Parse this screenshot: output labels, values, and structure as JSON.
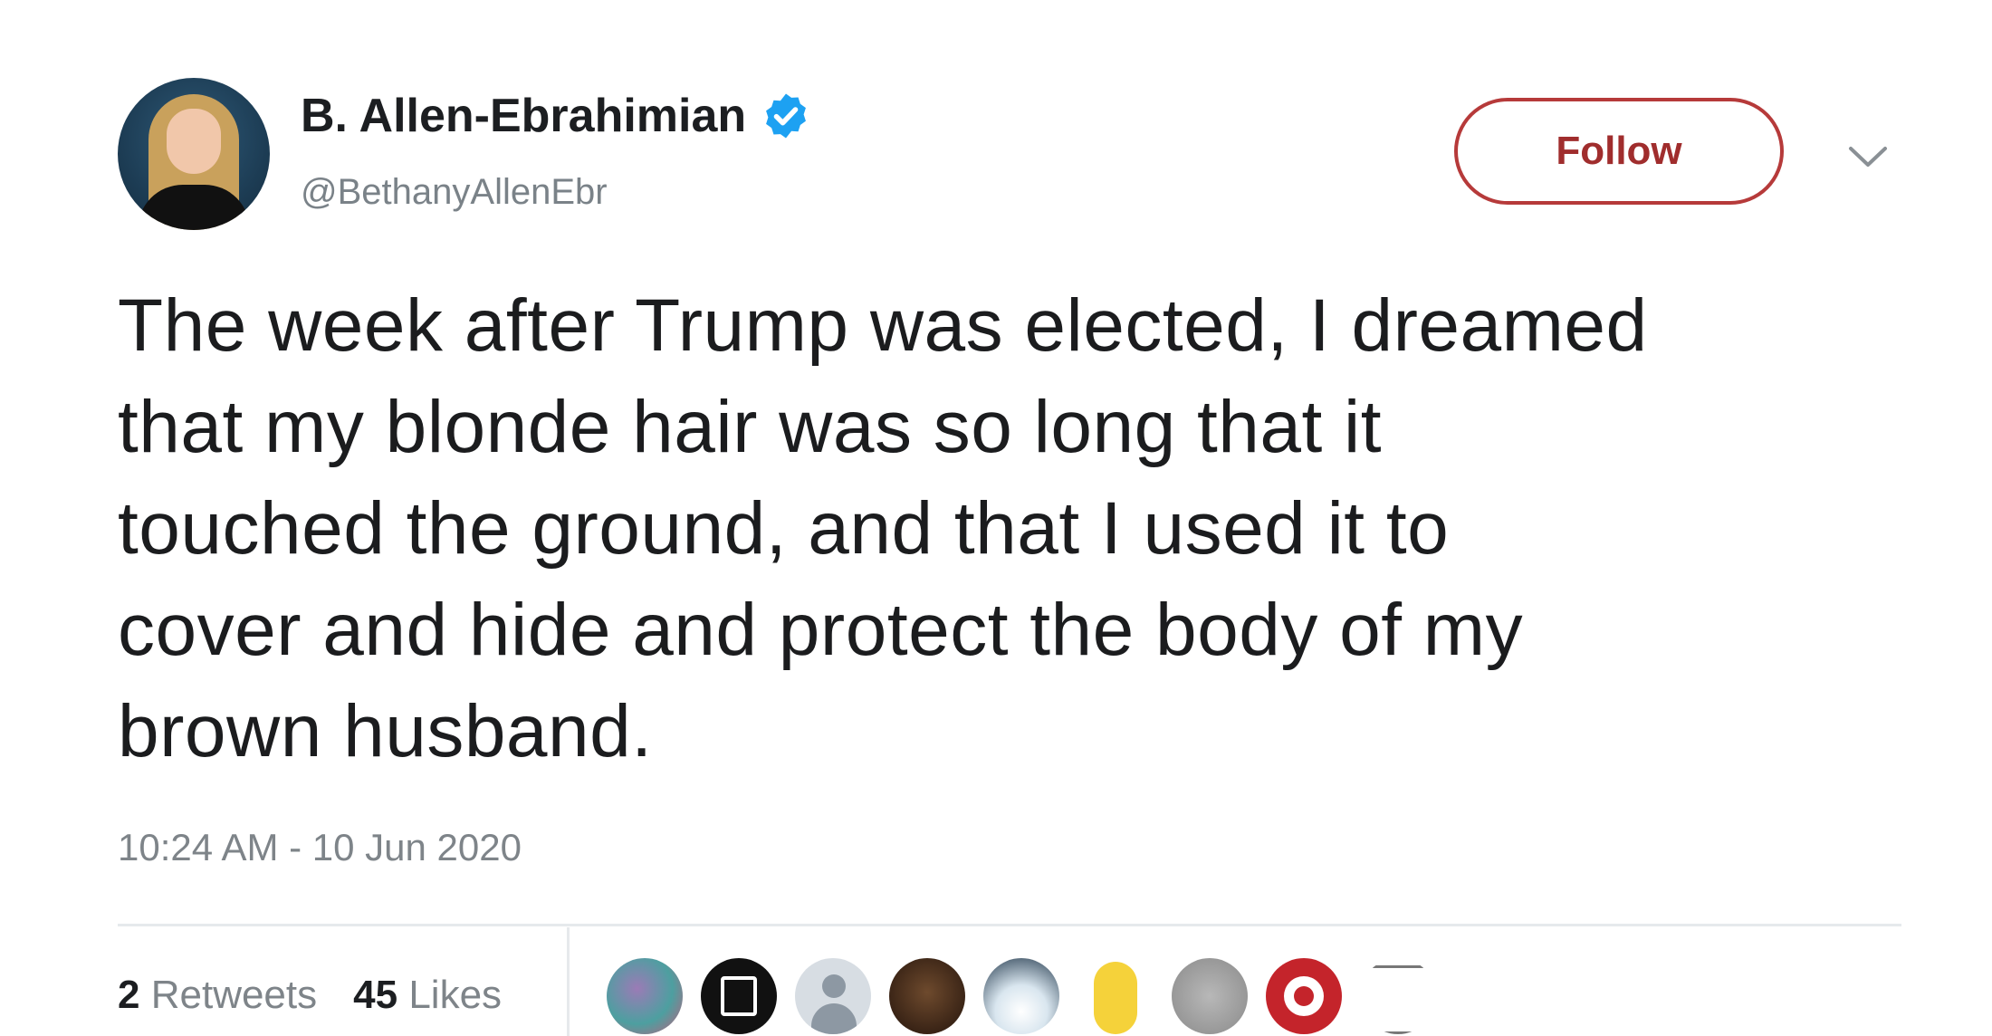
{
  "author": {
    "display_name": "B. Allen-Ebrahimian",
    "handle": "@BethanyAllenEbr",
    "verified": true
  },
  "header": {
    "follow_label": "Follow"
  },
  "tweet": {
    "text_lines": [
      "The week after Trump was elected, I dreamed",
      "that my blonde hair was so long that it",
      "touched the ground, and that I used it to",
      "cover and hide and protect the body of my",
      "brown husband."
    ],
    "timestamp": "10:24 AM - 10 Jun 2020"
  },
  "stats": {
    "retweets_count": "2",
    "retweets_label": "Retweets",
    "likes_count": "45",
    "likes_label": "Likes"
  },
  "colors": {
    "follow_border": "#b63a3a",
    "verified_blue": "#1da1f2"
  }
}
